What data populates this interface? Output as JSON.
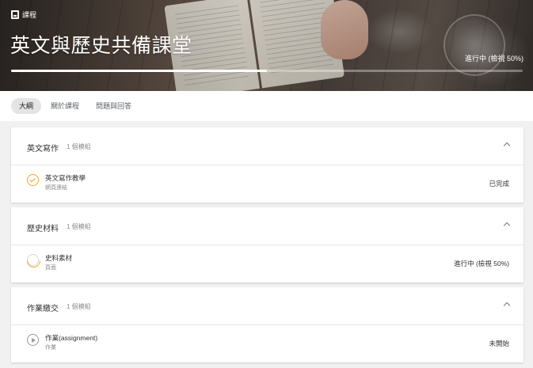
{
  "header": {
    "breadcrumb": "課程",
    "course_title": "英文與歷史共備課堂",
    "progress_fraction": 0.5,
    "status": "進行中 (檢視 50%)"
  },
  "tabs": [
    {
      "label": "大綱",
      "active": true
    },
    {
      "label": "關於課程",
      "active": false
    },
    {
      "label": "問題與回答",
      "active": false
    }
  ],
  "sections": [
    {
      "title": "英文寫作",
      "count": "1 個模組",
      "item": {
        "name": "英文寫作教學",
        "type": "網頁連結",
        "status": "已完成",
        "icon": "check-circle-icon"
      }
    },
    {
      "title": "歷史材料",
      "count": "1 個模組",
      "item": {
        "name": "史料素材",
        "type": "頁面",
        "status": "進行中 (檢視 50%)",
        "icon": "progress-circle-icon"
      }
    },
    {
      "title": "作業繳交",
      "count": "1 個模組",
      "item": {
        "name": "作業(assignment)",
        "type": "作業",
        "status": "未開始",
        "icon": "play-circle-icon"
      }
    }
  ],
  "colors": {
    "accent": "#f5a623",
    "background": "#f1f1f1",
    "card": "#ffffff"
  }
}
